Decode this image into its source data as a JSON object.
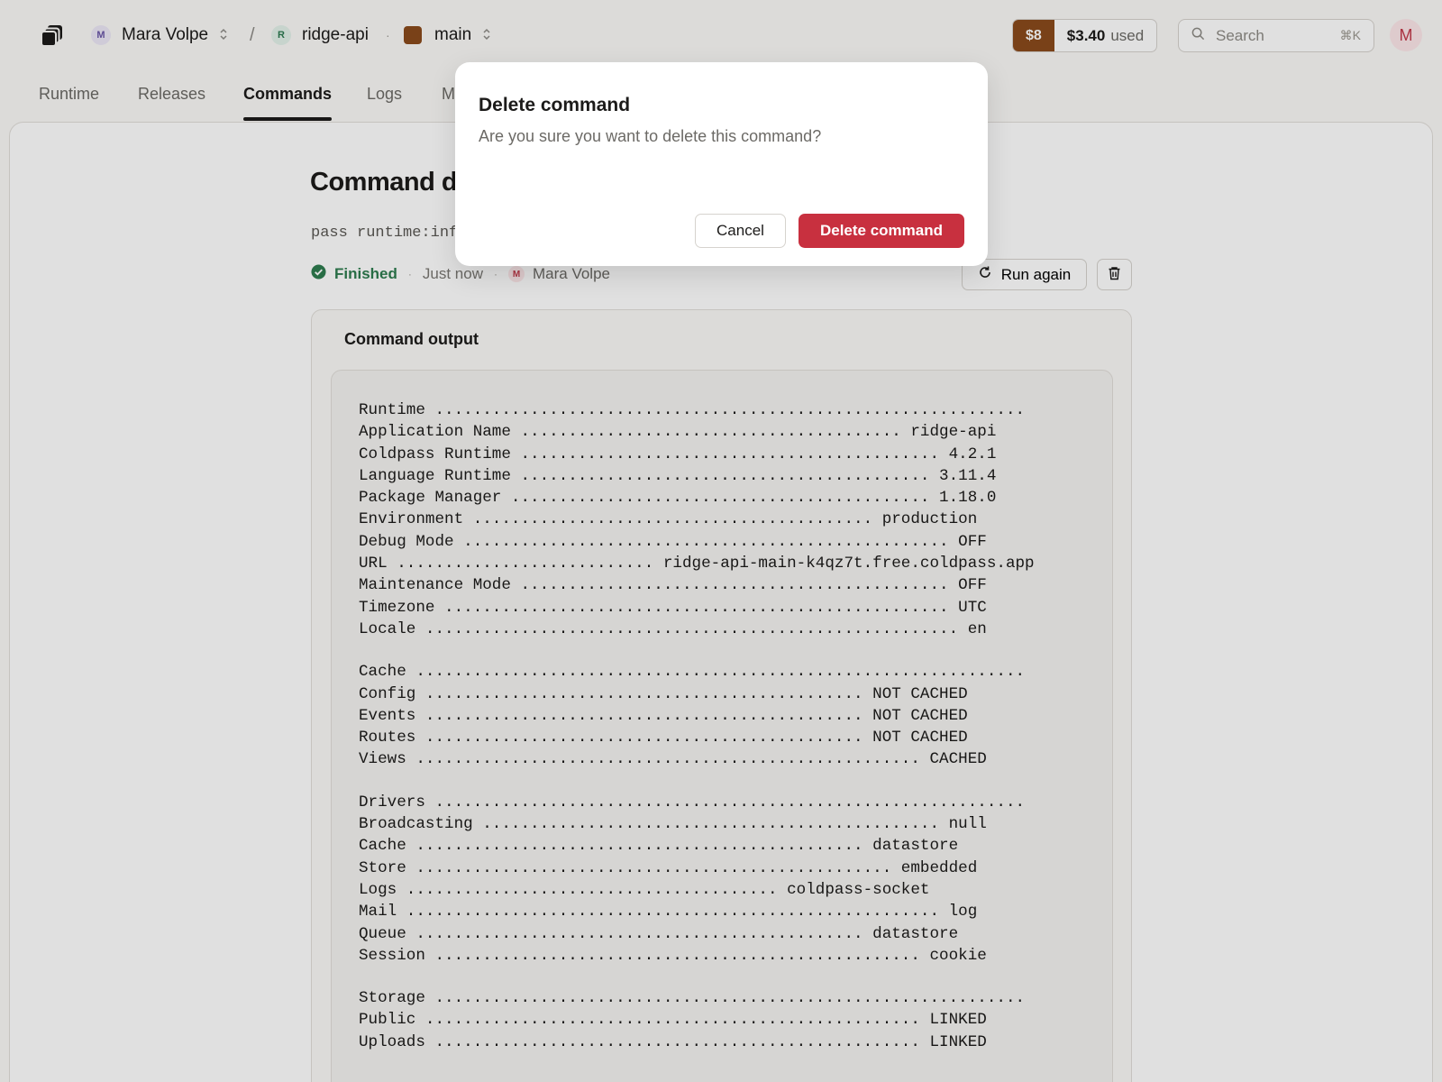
{
  "header": {
    "org": {
      "initial": "M",
      "name": "Mara Volpe"
    },
    "separator": "/",
    "project": {
      "initial": "R",
      "name": "ridge-api"
    },
    "dot": "·",
    "branch": {
      "name": "main",
      "color": "#8a4b1c"
    },
    "credit": {
      "amount": "$8",
      "used_value": "$3.40",
      "used_label": "used"
    },
    "search": {
      "placeholder": "Search",
      "shortcut": "⌘K"
    },
    "avatar_initial": "M"
  },
  "tabs": [
    {
      "label": "Runtime"
    },
    {
      "label": "Releases"
    },
    {
      "label": "Commands",
      "active": true
    },
    {
      "label": "Logs"
    },
    {
      "label": "M"
    }
  ],
  "command": {
    "title": "Command de",
    "command_text": "pass runtime:inf",
    "status": "Finished",
    "meta_sep": "·",
    "time": "Just now",
    "user_initial": "M",
    "user": "Mara Volpe",
    "run_again_label": "Run again"
  },
  "output": {
    "title": "Command output",
    "lines": [
      "Runtime ..............................................................",
      "Application Name ........................................ ridge-api",
      "Coldpass Runtime ............................................ 4.2.1",
      "Language Runtime ........................................... 3.11.4",
      "Package Manager ............................................ 1.18.0",
      "Environment .......................................... production",
      "Debug Mode ................................................... OFF",
      "URL ........................... ridge-api-main-k4qz7t.free.coldpass.app",
      "Maintenance Mode ............................................. OFF",
      "Timezone ..................................................... UTC",
      "Locale ........................................................ en",
      "",
      "Cache ................................................................",
      "Config .............................................. NOT CACHED",
      "Events .............................................. NOT CACHED",
      "Routes .............................................. NOT CACHED",
      "Views ..................................................... CACHED",
      "",
      "Drivers ..............................................................",
      "Broadcasting ................................................ null",
      "Cache ............................................... datastore",
      "Store .................................................. embedded",
      "Logs ....................................... coldpass-socket",
      "Mail ........................................................ log",
      "Queue ............................................... datastore",
      "Session ................................................... cookie",
      "",
      "Storage ..............................................................",
      "Public .................................................... LINKED",
      "Uploads ................................................... LINKED"
    ]
  },
  "modal": {
    "title": "Delete command",
    "body": "Are you sure you want to delete this command?",
    "cancel_label": "Cancel",
    "confirm_label": "Delete command"
  },
  "colors": {
    "success": "#2e7d4f",
    "danger": "#c8303f",
    "brand": "#8a4b1c"
  },
  "icons": [
    "stack-logo-icon",
    "chevron-updown-icon",
    "search-icon",
    "check-circle-icon",
    "refresh-icon",
    "trash-icon"
  ]
}
